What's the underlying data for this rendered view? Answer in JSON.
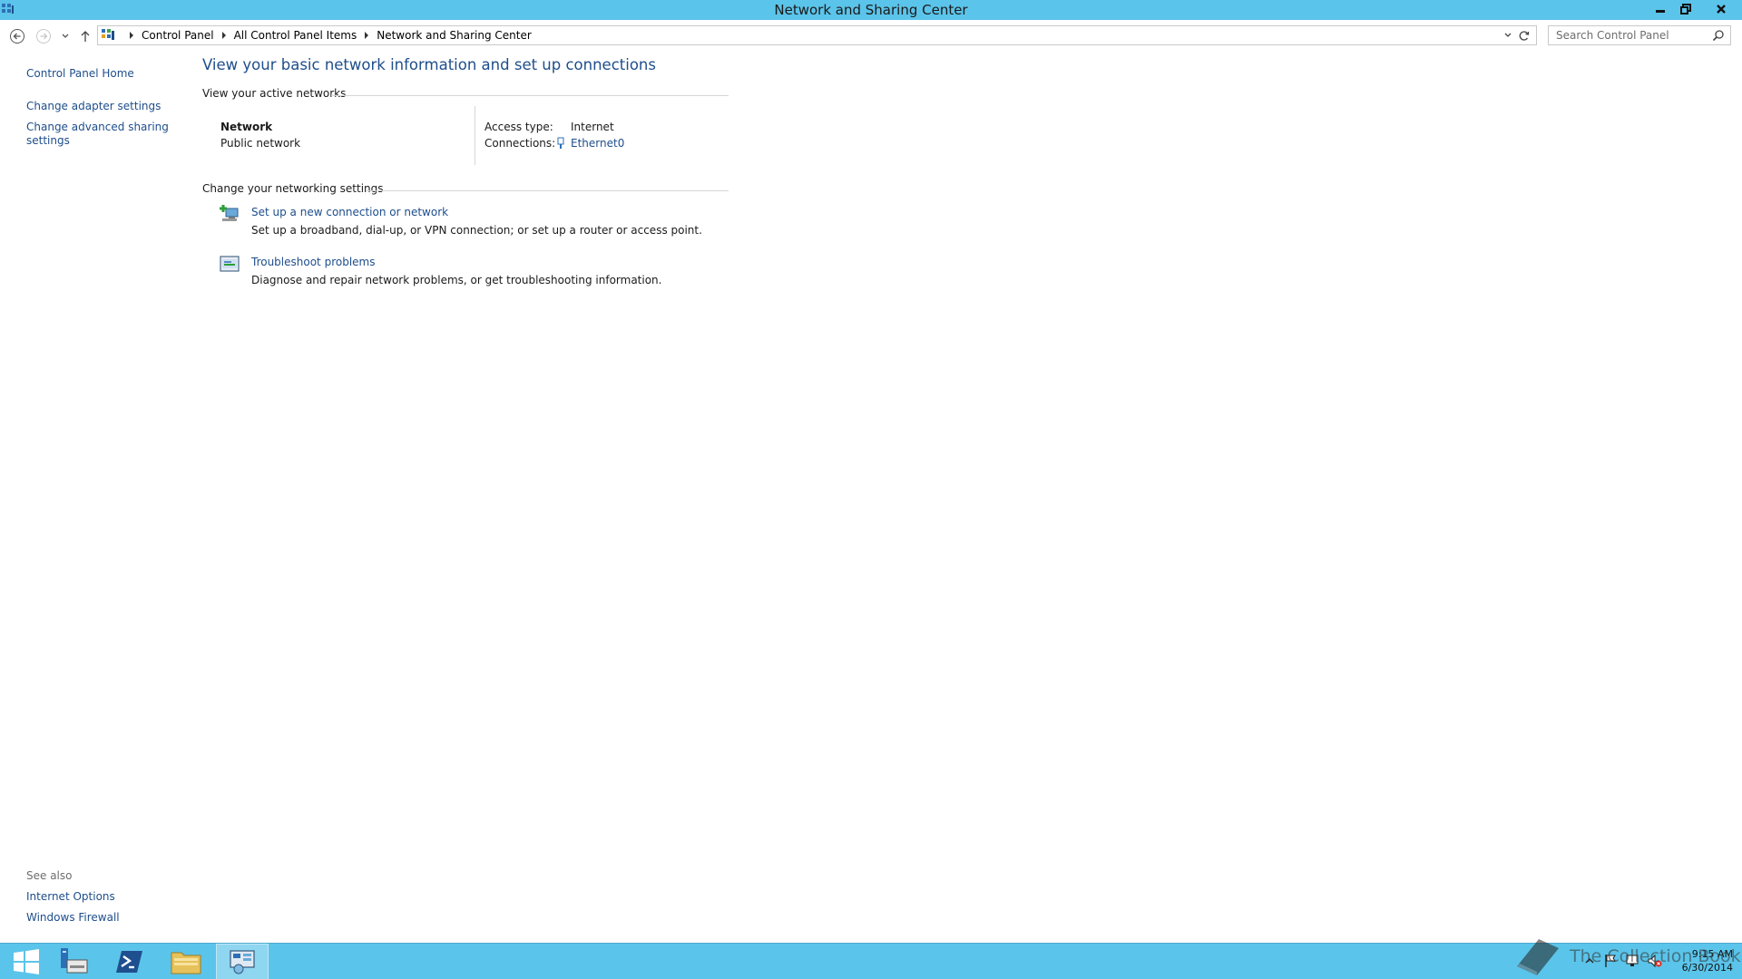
{
  "window": {
    "title": "Network and Sharing Center"
  },
  "address_bar": {
    "crumbs": [
      "Control Panel",
      "All Control Panel Items",
      "Network and Sharing Center"
    ]
  },
  "search": {
    "placeholder": "Search Control Panel"
  },
  "left_pane": {
    "home": "Control Panel Home",
    "adapter": "Change adapter settings",
    "advanced_line1": "Change advanced sharing",
    "advanced_line2": "settings",
    "see_also": "See also",
    "internet_options": "Internet Options",
    "firewall": "Windows Firewall"
  },
  "main": {
    "heading": "View your basic network information and set up connections",
    "active_networks_title": "View your active networks",
    "network_name": "Network",
    "network_type": "Public network",
    "access_type_label": "Access type:",
    "access_type_value": "Internet",
    "connections_label": "Connections:",
    "connections_value": "Ethernet0",
    "change_settings_title": "Change your networking settings",
    "tasks": [
      {
        "link": "Set up a new connection or network",
        "desc": "Set up a broadband, dial-up, or VPN connection; or set up a router or access point."
      },
      {
        "link": "Troubleshoot problems",
        "desc": "Diagnose and repair network problems, or get troubleshooting information."
      }
    ]
  },
  "taskbar": {
    "time": "9:15 AM",
    "date": "6/30/2014",
    "watermark": "The Collection Book"
  },
  "colors": {
    "titlebar": "#5bc4ea",
    "link": "#1e4e8c"
  }
}
